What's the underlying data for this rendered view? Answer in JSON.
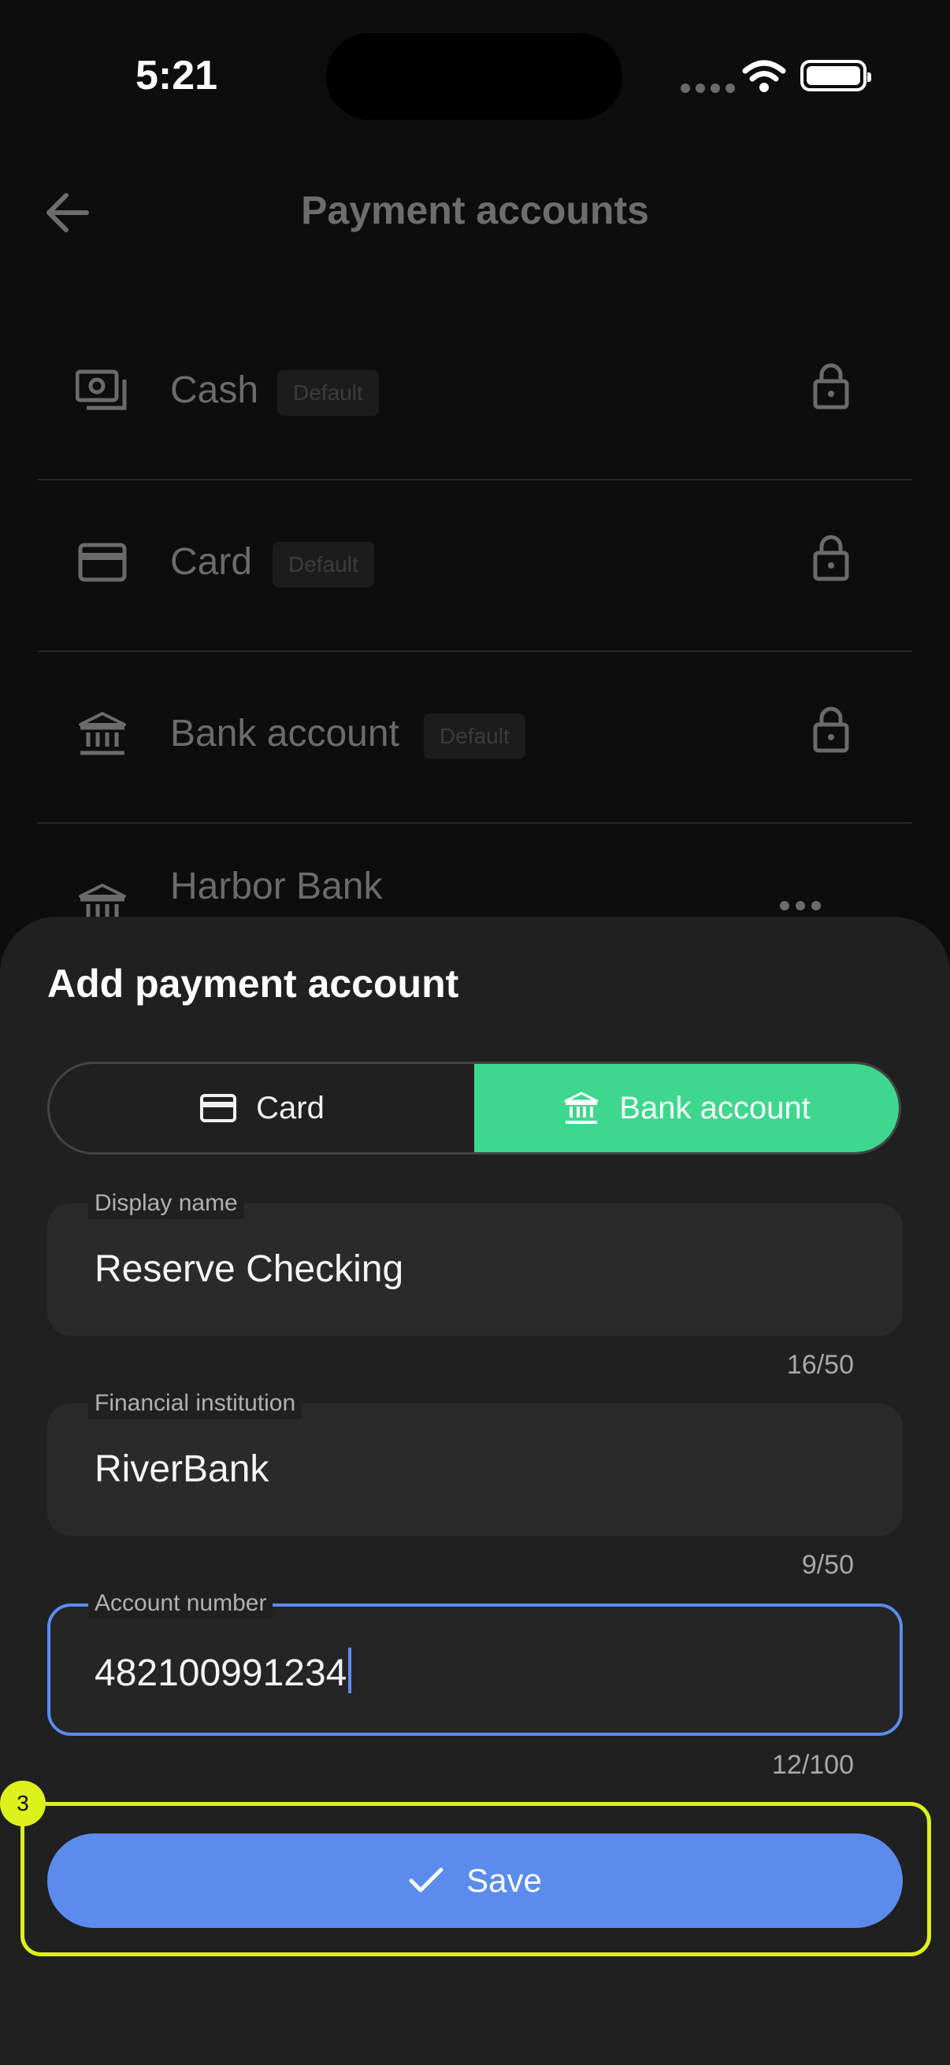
{
  "status_bar": {
    "time": "5:21"
  },
  "header": {
    "title": "Payment accounts"
  },
  "accounts": [
    {
      "label": "Cash",
      "badge": "Default",
      "icon": "cash-icon",
      "action": "lock-icon"
    },
    {
      "label": "Card",
      "badge": "Default",
      "icon": "card-icon",
      "action": "lock-icon"
    },
    {
      "label": "Bank account",
      "badge": "Default",
      "icon": "bank-icon",
      "action": "lock-icon"
    },
    {
      "label": "Harbor Bank",
      "icon": "bank-icon",
      "action": "more-icon"
    }
  ],
  "sheet": {
    "title": "Add payment account",
    "tabs": [
      {
        "label": "Card",
        "icon": "card-icon",
        "selected": false
      },
      {
        "label": "Bank account",
        "icon": "bank-icon",
        "selected": true
      }
    ],
    "fields": [
      {
        "label": "Display name",
        "value": "Reserve Checking",
        "counter": "16/50"
      },
      {
        "label": "Financial institution",
        "value": "RiverBank",
        "counter": "9/50"
      },
      {
        "label": "Account number",
        "value": "482100991234",
        "counter": "12/100",
        "focused": true
      }
    ],
    "save_label": "Save",
    "highlight_badge": "3"
  },
  "colors": {
    "accent_green": "#3dd88e",
    "accent_blue": "#5b8ced",
    "highlight": "#ddf21a"
  }
}
